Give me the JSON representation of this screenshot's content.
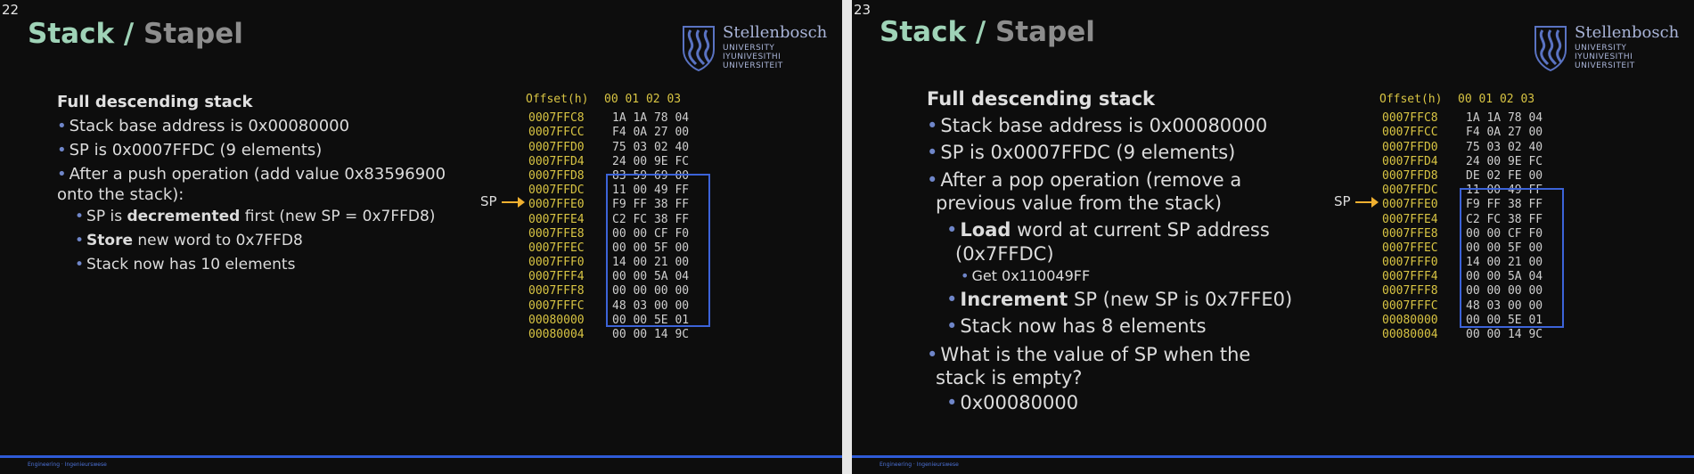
{
  "slides": [
    {
      "number": "22",
      "title_main": "Stack",
      "title_sep": "/",
      "title_alt": "Stapel",
      "logo": {
        "name": "Stellenbosch",
        "lines": [
          "UNIVERSITY",
          "IYUNIVESITHI",
          "UNIVERSITEIT"
        ]
      },
      "heading": "Full descending stack",
      "bullets": [
        {
          "level": 1,
          "parts": [
            "Stack base address is 0x00080000"
          ]
        },
        {
          "level": 1,
          "parts": [
            "SP is 0x0007FFDC (9 elements)"
          ]
        },
        {
          "level": 1,
          "parts": [
            "After a push operation (add value 0x83596900 onto the stack):"
          ]
        },
        {
          "level": 2,
          "bold": "",
          "pre": "SP is ",
          "strong": "decremented",
          "post": " first (new SP = 0x7FFD8)"
        },
        {
          "level": 2,
          "bold": "Store",
          "pre": "",
          "strong": "",
          "post": " new word to 0x7FFD8"
        },
        {
          "level": 2,
          "bold": "",
          "pre": "Stack now has 10 elements",
          "strong": "",
          "post": ""
        }
      ],
      "sp_label": "SP",
      "footer": "Engineering · Ingenieurswese"
    },
    {
      "number": "23",
      "title_main": "Stack",
      "title_sep": "/",
      "title_alt": "Stapel",
      "logo": {
        "name": "Stellenbosch",
        "lines": [
          "UNIVERSITY",
          "IYUNIVESITHI",
          "UNIVERSITEIT"
        ]
      },
      "heading": "Full descending stack",
      "bullets": [
        "Stack base address is 0x00080000",
        "SP is 0x0007FFDC (9 elements)",
        "After a pop operation (remove a previous value from the stack)",
        "Load",
        " word at current SP address (0x7FFDC)",
        "Get 0x110049FF",
        "Increment",
        " SP (new SP is 0x7FFE0)",
        "Stack now has 8 elements",
        "What is the value of SP when the stack is empty?",
        "0x00080000"
      ],
      "sp_label": "SP",
      "footer": "Engineering · Ingenieurswese"
    }
  ],
  "memory_table": {
    "header": {
      "offset": "Offset(h)",
      "cols": "00 01 02 03"
    },
    "rows": [
      {
        "offset": "0007FFC8",
        "bytes": "1A 1A 78 04"
      },
      {
        "offset": "0007FFCC",
        "bytes": "F4 0A 27 00"
      },
      {
        "offset": "0007FFD0",
        "bytes": "75 03 02 40"
      },
      {
        "offset": "0007FFD4",
        "bytes": "24 00 9E FC"
      },
      {
        "offset": "0007FFD8",
        "bytes": "83 59 69 00"
      },
      {
        "offset": "0007FFDC",
        "bytes": "11 00 49 FF"
      },
      {
        "offset": "0007FFE0",
        "bytes": "F9 FF 38 FF"
      },
      {
        "offset": "0007FFE4",
        "bytes": "C2 FC 38 FF"
      },
      {
        "offset": "0007FFE8",
        "bytes": "00 00 CF F0"
      },
      {
        "offset": "0007FFEC",
        "bytes": "00 00 5F 00"
      },
      {
        "offset": "0007FFF0",
        "bytes": "14 00 21 00"
      },
      {
        "offset": "0007FFF4",
        "bytes": "00 00 5A 04"
      },
      {
        "offset": "0007FFF8",
        "bytes": "00 00 00 00"
      },
      {
        "offset": "0007FFFC",
        "bytes": "48 03 00 00"
      },
      {
        "offset": "00080000",
        "bytes": "00 00 5E 01"
      },
      {
        "offset": "00080004",
        "bytes": "00 00 14 9C"
      }
    ],
    "row_d8_slide_b": "DE 02 FE 00"
  },
  "colors": {
    "background": "#0d0d0d",
    "title_accent": "#9fd3b7",
    "title_alt": "#8d8d8d",
    "offset_text": "#d8c443",
    "highlight_border": "#3c63d8",
    "arrow": "#f0b030",
    "bullet": "#6f86c9"
  }
}
